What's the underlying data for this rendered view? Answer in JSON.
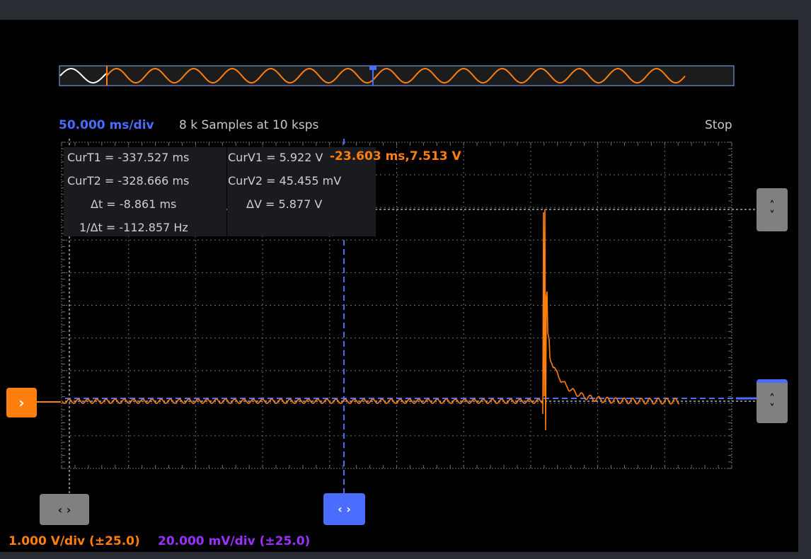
{
  "timebase": "50.000 ms/div",
  "samples": "8 k Samples at 10 ksps",
  "run_state": "Stop",
  "cursor_readout": {
    "curT1": "CurT1 = -337.527 ms",
    "curT2": "CurT2 = -328.666 ms",
    "dt": "Δt = -8.861 ms",
    "inv_dt": "1/Δt = -112.857 Hz",
    "curV1": "CurV1 = 5.922 V",
    "curV2": "CurV2 = 45.455 mV",
    "dv": "ΔV =  5.877 V"
  },
  "hover_readout": "-23.603 ms,7.513 V",
  "ch1_scale": "1.000 V/div (±25.0)",
  "ch2_scale": "20.000 mV/div (±25.0)",
  "icons": {
    "left_right": "‹ ›",
    "up": "˄",
    "down": "˅",
    "trigger_marker": "›"
  },
  "colors": {
    "ch1": "#ff7f0e",
    "ch2": "#9b30ff",
    "accent": "#4a6cff",
    "cursor_line": "#ffffff",
    "grid": "#7a7a7a",
    "background": "#000000"
  }
}
